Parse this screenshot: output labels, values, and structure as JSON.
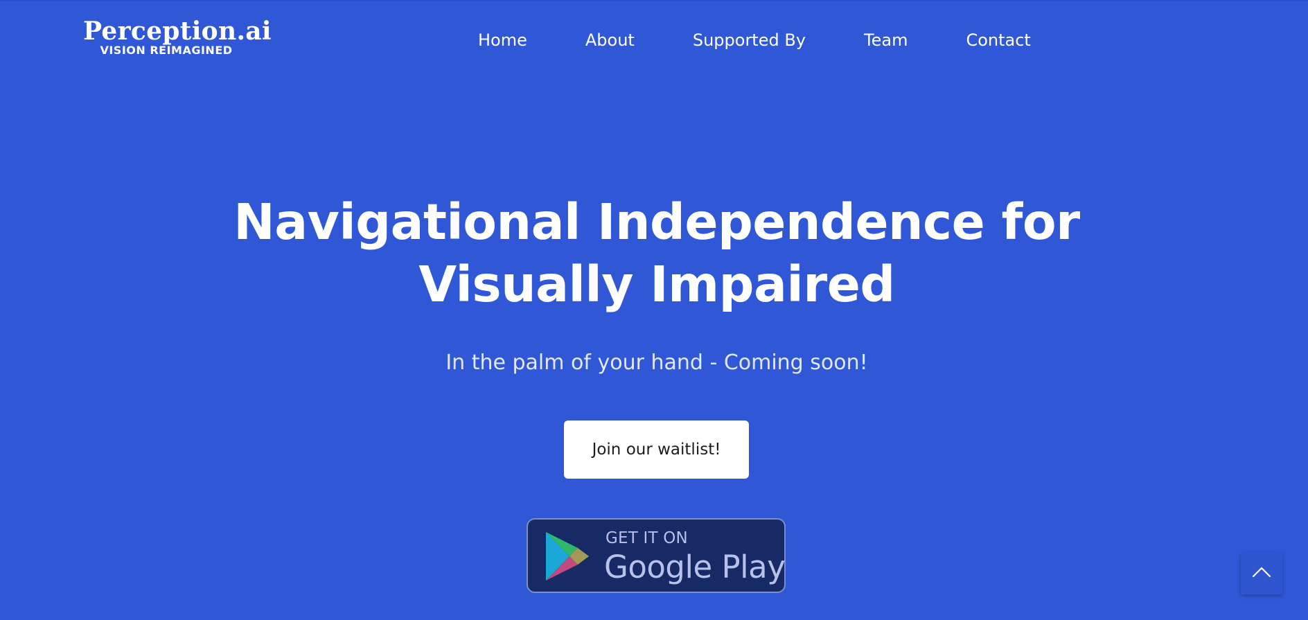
{
  "logo": {
    "name": "Perception.ai",
    "tagline": "VISION REIMAGINED"
  },
  "nav": {
    "home": "Home",
    "about": "About",
    "supported_by": "Supported By",
    "team": "Team",
    "contact": "Contact"
  },
  "hero": {
    "title_line1": "Navigational Independence for",
    "title_line2": "Visually Impaired",
    "subtitle": "In the palm of your hand - Coming soon!",
    "cta_label": "Join our waitlist!"
  },
  "store_badge": {
    "small_text": "GET IT ON",
    "store_name": "Google Play",
    "icon": "google-play-icon"
  },
  "back_to_top": {
    "icon": "chevron-up-icon"
  },
  "colors": {
    "background": "#3058d6",
    "badge_bg": "#182a66",
    "button_bg": "#ffffff"
  }
}
